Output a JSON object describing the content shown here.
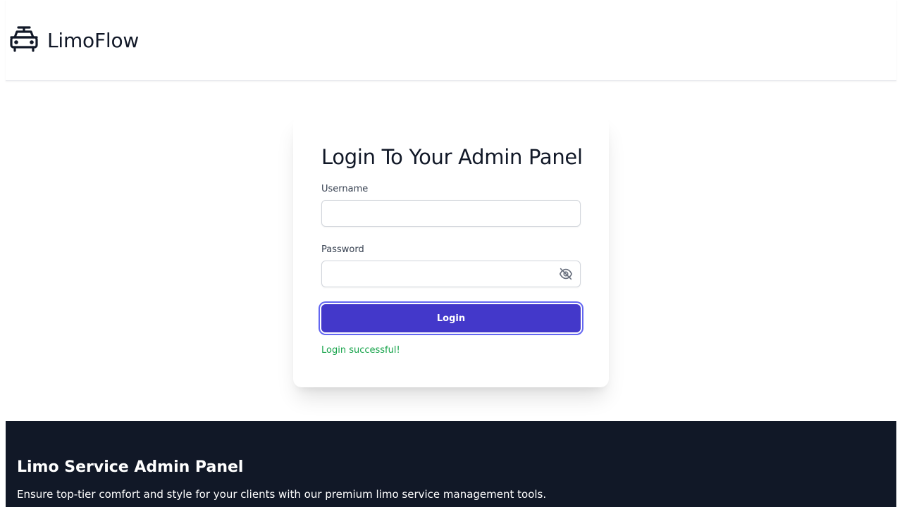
{
  "header": {
    "brand": "LimoFlow",
    "logo_icon": "car-icon"
  },
  "login": {
    "title": "Login To Your Admin Panel",
    "username_label": "Username",
    "username_value": "",
    "password_label": "Password",
    "password_value": "",
    "password_toggle_icon": "eye-off-icon",
    "button_label": "Login",
    "status_message": "Login successful!"
  },
  "footer": {
    "title": "Limo Service Admin Panel",
    "text": "Ensure top-tier comfort and style for your clients with our premium limo service management tools."
  },
  "colors": {
    "accent": "#4338ca",
    "success": "#16a34a",
    "footer_bg": "#111827"
  }
}
